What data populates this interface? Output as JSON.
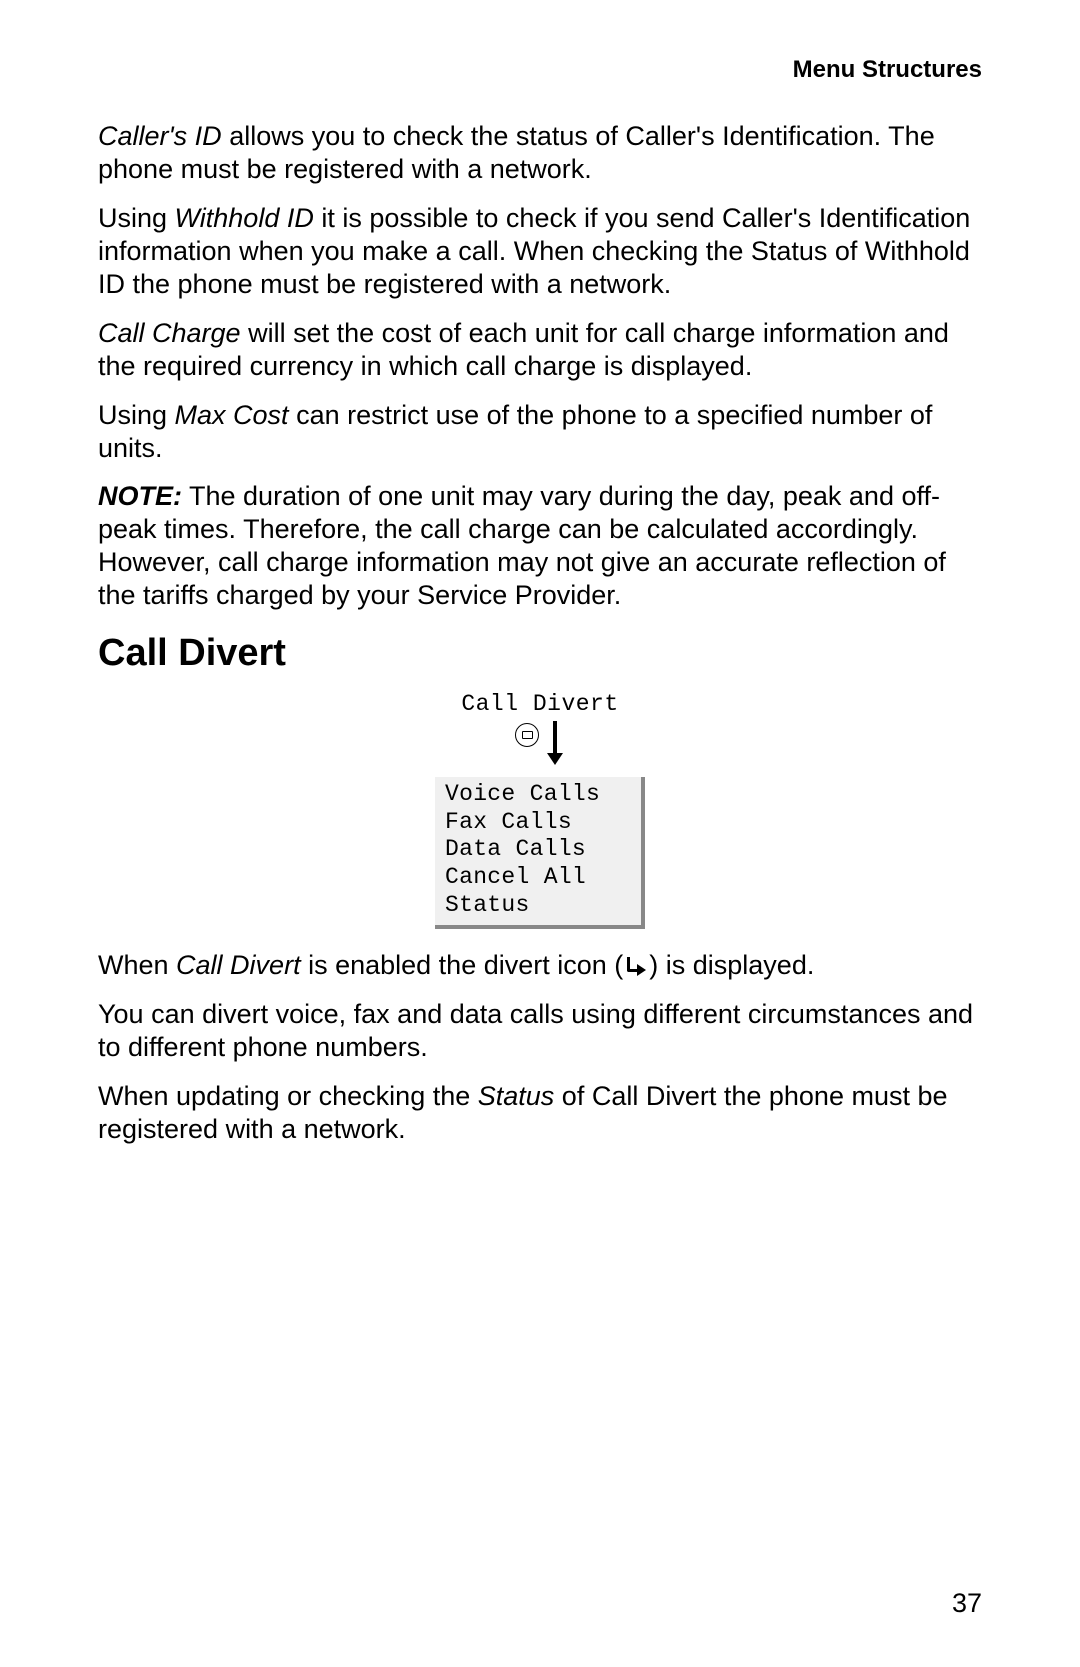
{
  "header": "Menu Structures",
  "para1": {
    "lead_italic": "Caller's ID",
    "rest": " allows you to check the status of Caller's Identification. The phone must be registered with a network."
  },
  "para2": {
    "pre": "Using ",
    "italic": "Withhold ID",
    "post": " it is possible to check if you send Caller's Identification information when you make a call. When checking the Status of Withhold ID the phone must be registered with a network."
  },
  "para3": {
    "lead_italic": "Call Charge",
    "rest": " will set the cost of each unit for call charge information and the required currency in which call charge is displayed."
  },
  "para4": {
    "pre": "Using ",
    "italic": "Max Cost",
    "post": " can restrict use of the phone to a specified number of units."
  },
  "note": {
    "label": "NOTE:",
    "text": " The duration of one unit may vary during the day, peak and off-peak times. Therefore, the call charge can be calculated accordingly. However, call charge information may not give an accurate reflection of the tariffs charged by your Service Provider."
  },
  "section_heading": "Call Divert",
  "diagram": {
    "title": "Call Divert",
    "menu_items": [
      "Voice Calls",
      "Fax Calls",
      "Data Calls",
      "Cancel All",
      "Status"
    ]
  },
  "para5": {
    "pre": "When ",
    "italic": "Call Divert",
    "mid": " is enabled the divert icon (",
    "end": ") is displayed."
  },
  "para6": "You can divert voice, fax and data calls using different circumstances and to different phone numbers.",
  "para7": {
    "pre": "When updating or checking the ",
    "italic": "Status",
    "post": " of Call Divert the phone must be registered with a network."
  },
  "page_number": "37"
}
